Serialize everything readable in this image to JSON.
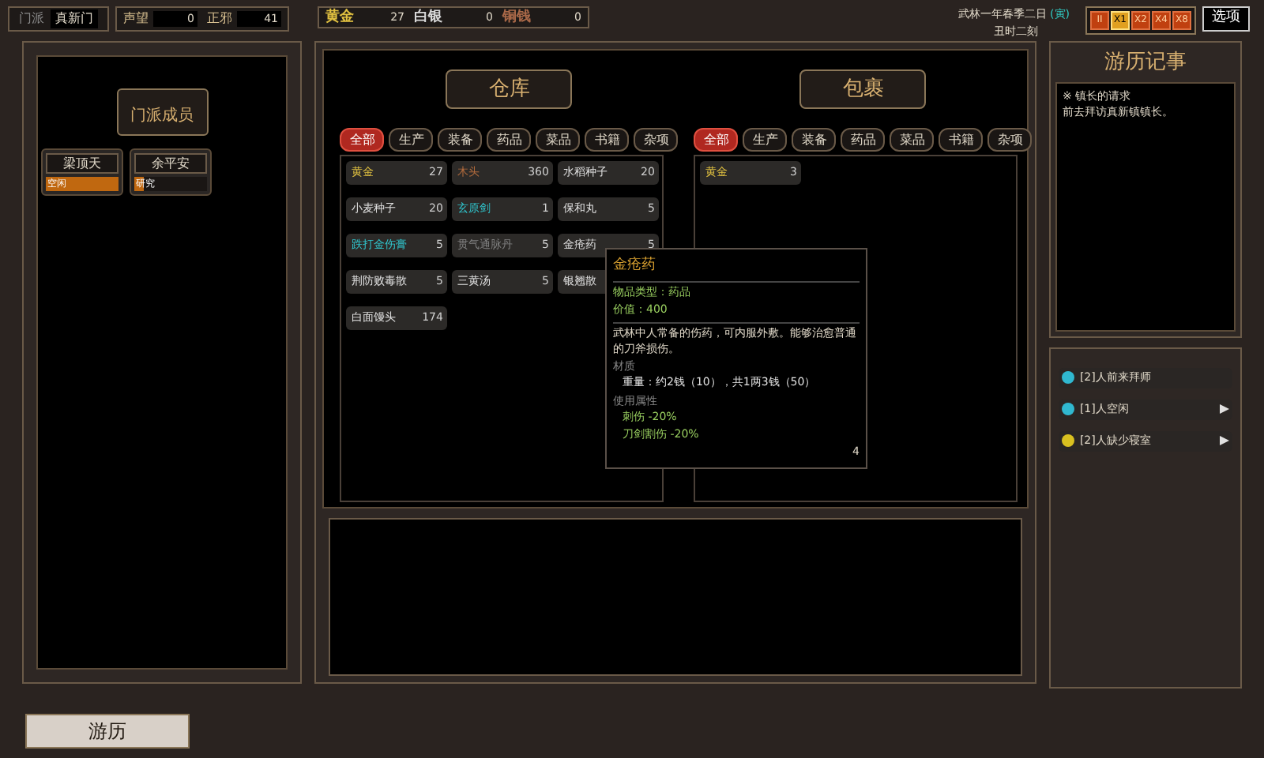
{
  "top_bar": {
    "sect_label": "门派",
    "sect_name": "真新门",
    "stats": [
      {
        "label": "声望",
        "value": "0"
      },
      {
        "label": "正邪",
        "value": "41"
      }
    ],
    "currency": [
      {
        "label": "黄金",
        "value": "27",
        "color": "#e0c040"
      },
      {
        "label": "白银",
        "value": "0",
        "color": "#d8d8d8"
      },
      {
        "label": "铜钱",
        "value": "0",
        "color": "#a86848"
      }
    ],
    "date": "武林一年春季二日",
    "hour_branch": "(寅)",
    "time": "丑时二刻",
    "speed_buttons": [
      {
        "label": "II",
        "selected": false
      },
      {
        "label": "X1",
        "selected": true
      },
      {
        "label": "X2",
        "selected": false
      },
      {
        "label": "X4",
        "selected": false
      },
      {
        "label": "X8",
        "selected": false
      }
    ],
    "options_button": "选项"
  },
  "members_panel": {
    "title": "门派成员",
    "members": [
      {
        "name": "梁顶天",
        "status": "空闲",
        "level": 1
      },
      {
        "name": "余平安",
        "status": "研究",
        "level": 0.12
      }
    ]
  },
  "warehouse": {
    "title": "仓库",
    "tabs": [
      {
        "label": "全部",
        "selected": true
      },
      {
        "label": "生产",
        "selected": false
      },
      {
        "label": "装备",
        "selected": false
      },
      {
        "label": "药品",
        "selected": false
      },
      {
        "label": "菜品",
        "selected": false
      },
      {
        "label": "书籍",
        "selected": false
      },
      {
        "label": "杂项",
        "selected": false
      }
    ],
    "items": [
      {
        "name": "黄金",
        "count": "27",
        "color": "#e0c040"
      },
      {
        "name": "木头",
        "count": "360",
        "color": "#b06a3c"
      },
      {
        "name": "水稻种子",
        "count": "20",
        "color": "#e0e0e0"
      },
      {
        "name": "小麦种子",
        "count": "20",
        "color": "#e0e0e0"
      },
      {
        "name": "玄原剑",
        "count": "1",
        "color": "#30c8d0"
      },
      {
        "name": "保和丸",
        "count": "5",
        "color": "#e0e0e0"
      },
      {
        "name": "跌打金伤膏",
        "count": "5",
        "color": "#30c8d0"
      },
      {
        "name": "贯气通脉丹",
        "count": "5",
        "color": "#808080"
      },
      {
        "name": "金疮药",
        "count": "5",
        "color": "#e0e0e0"
      },
      {
        "name": "荆防败毒散",
        "count": "5",
        "color": "#e0e0e0"
      },
      {
        "name": "三黄汤",
        "count": "5",
        "color": "#e0e0e0"
      },
      {
        "name": "银翘散",
        "color": "#e0e0e0"
      },
      {
        "name": "白面馒头",
        "count": "174",
        "color": "#e0e0e0"
      }
    ]
  },
  "bag": {
    "title": "包裹",
    "tabs": [
      {
        "label": "全部",
        "selected": true
      },
      {
        "label": "生产",
        "selected": false
      },
      {
        "label": "装备",
        "selected": false
      },
      {
        "label": "药品",
        "selected": false
      },
      {
        "label": "菜品",
        "selected": false
      },
      {
        "label": "书籍",
        "selected": false
      },
      {
        "label": "杂项",
        "selected": false
      }
    ],
    "items": [
      {
        "name": "黄金",
        "count": "3",
        "color": "#e0c040"
      }
    ]
  },
  "tooltip": {
    "title": "金疮药",
    "type": "物品类型：药品",
    "value": "价值：400",
    "description": "武林中人常备的伤药，可内服外敷。能够治愈普通的刀斧损伤。",
    "sections": [
      {
        "title": "材质",
        "lines": [
          {
            "text": "重量：约2钱（10），共1两3钱（50）",
            "color": "#e0e0e0"
          }
        ]
      },
      {
        "title": "使用属性",
        "lines": [
          {
            "text": "刺伤 -20%",
            "color": "#9ad060"
          },
          {
            "text": "刀剑割伤 -20%",
            "color": "#9ad060"
          }
        ]
      }
    ],
    "count": "4"
  },
  "journal": {
    "title": "游历记事",
    "quest_title": "※ 镇长的请求",
    "quest_text": "前去拜访真新镇镇长。"
  },
  "notifications": [
    {
      "text": "[2]人前来拜师",
      "color": "#30b8d0",
      "arrow": false
    },
    {
      "text": "[1]人空闲",
      "color": "#30b8d0",
      "arrow": true
    },
    {
      "text": "[2]人缺少寝室",
      "color": "#d8c020",
      "arrow": true
    }
  ],
  "travel_button": "游历"
}
